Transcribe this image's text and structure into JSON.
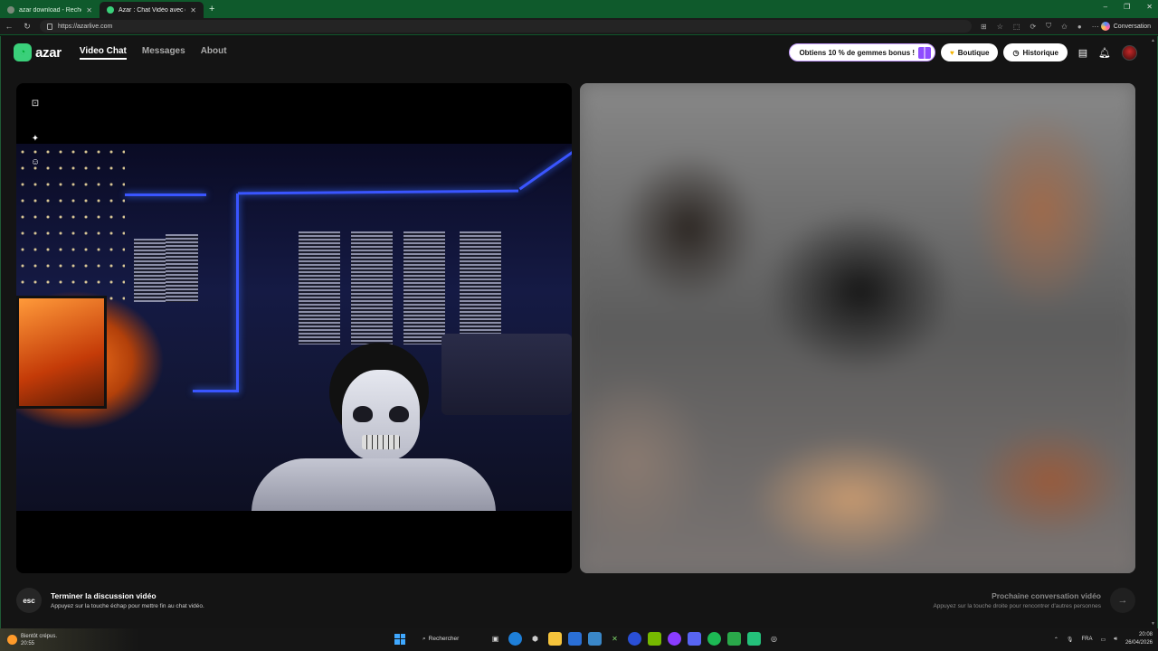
{
  "browser": {
    "tabs": [
      {
        "title": "azar download - Recherche",
        "active": false
      },
      {
        "title": "Azar : Chat Vidéo avec de no",
        "active": true
      }
    ],
    "new_tab": "+",
    "url": "https://azarlive.com",
    "profile_label": "Conversation",
    "window_controls": [
      "–",
      "❐",
      "✕"
    ]
  },
  "app": {
    "logo_text": "azar",
    "nav": [
      {
        "label": "Video Chat",
        "active": true
      },
      {
        "label": "Messages",
        "active": false
      },
      {
        "label": "About",
        "active": false
      }
    ],
    "promo_label": "Obtiens 10 % de gemmes bonus !",
    "shop_label": "Boutique",
    "history_label": "Historique",
    "accent_color": "#3ad07a",
    "promo_accent": "#8e4dff"
  },
  "footer": {
    "esc_key": "esc",
    "end_title": "Terminer la discussion vidéo",
    "end_sub": "Appuyez sur la touche échap pour mettre fin au chat vidéo.",
    "next_title": "Prochaine conversation vidéo",
    "next_sub": "Appuyez sur la touche droite pour rencontrer d'autres personnes",
    "next_arrow": "→"
  },
  "taskbar": {
    "weather_label": "Bientôt crépus.",
    "weather_time": "20:55",
    "search_label": "Rechercher",
    "lang": "FRA",
    "time": "20:08",
    "date": "26/04/2026"
  }
}
